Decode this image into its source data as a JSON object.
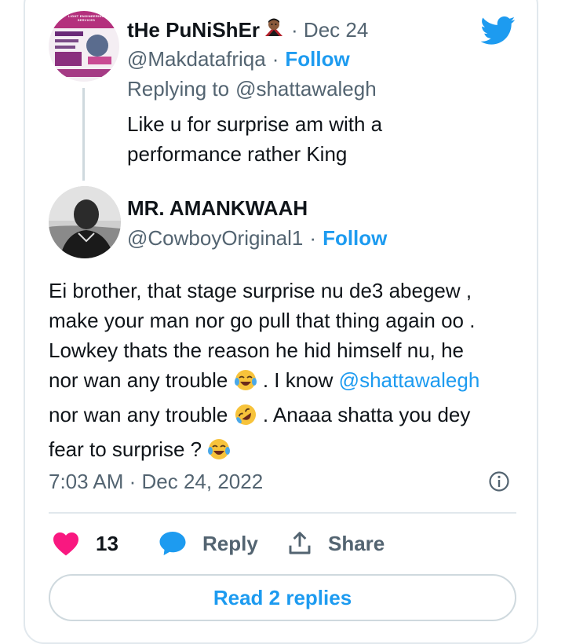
{
  "reply_tweet": {
    "display_name": "tHe PuNiShEr",
    "handle": "@Makdatafriqa",
    "date": "· Dec 24",
    "follow_label": "Follow",
    "replying_prefix": "Replying to",
    "replying_to": "@shattawalegh",
    "lines": [
      "Like u for surprise am with a",
      "performance rather King"
    ],
    "avatar_flyer_heading": "LIGHT ENGINEERING SERVICES"
  },
  "main_tweet": {
    "display_name": "MR. AMANKWAAH",
    "handle": "@CowboyOriginal1",
    "follow_label": "Follow",
    "line1": "Ei brother,  that stage surprise nu de3 abegew ,",
    "line2": "make your man nor go pull that thing again oo .",
    "line3": "Lowkey thats the reason he hid himself nu, he",
    "line4_a": "nor wan any trouble",
    "line4_b": ". I know",
    "line4_mention": "@shattawalegh",
    "line5_a": "nor wan any trouble",
    "line5_b": ". Anaaa shatta you dey",
    "line6_a": "fear to surprise ?",
    "timestamp": "7:03 AM · Dec 24, 2022"
  },
  "actions": {
    "like_count": "13",
    "reply_label": "Reply",
    "share_label": "Share"
  },
  "read_replies_label": "Read 2 replies",
  "icons": {
    "brand": "twitter-bird-icon",
    "like": "heart-icon",
    "reply": "speech-bubble-icon",
    "share": "share-icon",
    "info": "info-icon",
    "emojis": [
      "vampire-emoji",
      "tears-of-joy-emoji",
      "rolling-on-floor-laughing-emoji"
    ]
  },
  "colors": {
    "accent": "#1d9bf0",
    "like": "#f91880",
    "text": "#0f1419",
    "muted": "#536471",
    "border": "#e1e8ed"
  }
}
